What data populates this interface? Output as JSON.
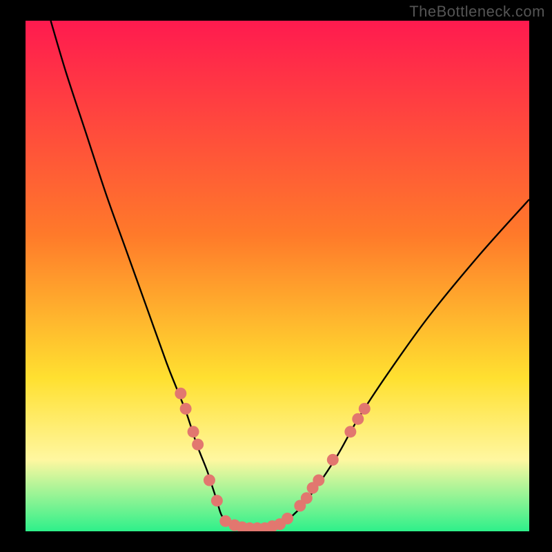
{
  "watermark": "TheBottleneck.com",
  "colors": {
    "background": "#000000",
    "watermark": "#555555",
    "curve": "#000000",
    "marker_fill": "#e2776f",
    "marker_stroke": "#c45b54",
    "gradient_top": "#ff1a4f",
    "gradient_mid1": "#ff7a2a",
    "gradient_mid2": "#ffe030",
    "gradient_mid3": "#fff7a0",
    "gradient_bottom": "#2ef08a"
  },
  "chart_data": {
    "type": "line",
    "title": "",
    "xlabel": "",
    "ylabel": "",
    "xlim": [
      0,
      100
    ],
    "ylim": [
      0,
      100
    ],
    "grid": false,
    "notes": "V-shaped bottleneck curve on a vertical rainbow heat gradient. Axes unlabeled; values are percentages read from geometry (0 at bottom-left, 100 at top / right).",
    "series": [
      {
        "name": "curve",
        "x": [
          5,
          8,
          12,
          16,
          20,
          24,
          28,
          30,
          32,
          34,
          36,
          37,
          38,
          39,
          41,
          43,
          45,
          47,
          50,
          54,
          58,
          62,
          66,
          72,
          80,
          90,
          100
        ],
        "y": [
          100,
          90,
          78,
          66,
          55,
          44,
          33,
          28,
          23,
          17,
          12,
          9,
          6,
          3,
          1,
          0.5,
          0.5,
          0.5,
          1,
          4,
          9,
          15,
          22,
          31,
          42,
          54,
          65
        ]
      }
    ],
    "markers": [
      {
        "x": 30.8,
        "y": 27
      },
      {
        "x": 31.8,
        "y": 24
      },
      {
        "x": 33.3,
        "y": 19.5
      },
      {
        "x": 34.2,
        "y": 17
      },
      {
        "x": 36.5,
        "y": 10
      },
      {
        "x": 38.0,
        "y": 6
      },
      {
        "x": 39.7,
        "y": 2.0
      },
      {
        "x": 41.5,
        "y": 1.2
      },
      {
        "x": 43.0,
        "y": 0.8
      },
      {
        "x": 44.5,
        "y": 0.6
      },
      {
        "x": 46.0,
        "y": 0.6
      },
      {
        "x": 47.5,
        "y": 0.6
      },
      {
        "x": 49.0,
        "y": 1.0
      },
      {
        "x": 50.5,
        "y": 1.4
      },
      {
        "x": 52.0,
        "y": 2.5
      },
      {
        "x": 54.5,
        "y": 5
      },
      {
        "x": 55.8,
        "y": 6.5
      },
      {
        "x": 57.0,
        "y": 8.5
      },
      {
        "x": 58.2,
        "y": 10
      },
      {
        "x": 61.0,
        "y": 14
      },
      {
        "x": 64.5,
        "y": 19.5
      },
      {
        "x": 66.0,
        "y": 22
      },
      {
        "x": 67.3,
        "y": 24
      }
    ]
  }
}
